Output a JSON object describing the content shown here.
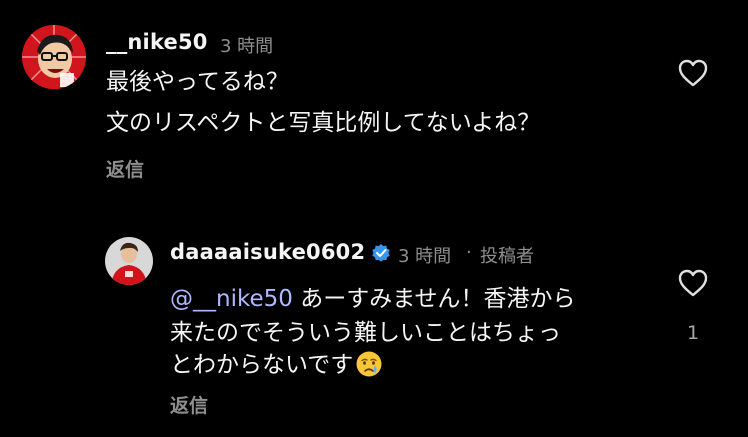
{
  "comment1": {
    "username": "__nike50",
    "time": "3 時間",
    "lines": [
      "最後やってるね？",
      "文のリスペクトと写真比例してないよね？"
    ],
    "reply_label": "返信"
  },
  "comment2": {
    "username": "daaaaisuke0602",
    "time": "3 時間",
    "separator": "·",
    "author_badge": "投稿者",
    "mention": "@__nike50",
    "line1_rest": " あーすみません！香港から",
    "line2": "来たのでそういう難しいことはちょっ",
    "line3": "とわからないです",
    "reply_label": "返信",
    "like_count": "1"
  },
  "colors": {
    "background": "#000000",
    "text": "#f5f5f5",
    "muted": "#8e8e8e",
    "mention": "#b0b8ff",
    "verified": "#3797f0"
  },
  "icons": {
    "heart": "heart-outline-icon",
    "verified": "verified-badge-icon",
    "emoji": "crying-face-emoji"
  }
}
